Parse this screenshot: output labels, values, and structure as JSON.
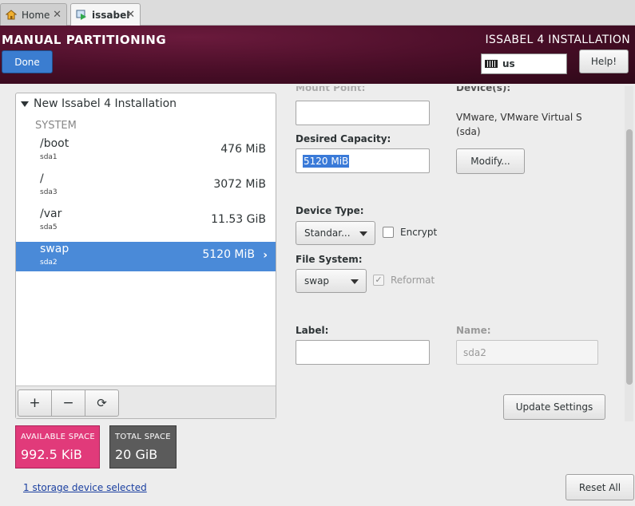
{
  "browser": {
    "tabs": [
      {
        "label": "Home",
        "icon": "home-icon"
      },
      {
        "label": "issabel",
        "icon": "vm-play-icon"
      }
    ],
    "close_glyph": "✕"
  },
  "header": {
    "title": "MANUAL PARTITIONING",
    "done_label": "Done",
    "install_title": "ISSABEL 4 INSTALLATION",
    "keyboard_layout": "us",
    "help_label": "Help!",
    "colors": {
      "banner": "#4a0e28",
      "done_button": "#3b7dd0"
    }
  },
  "partitions": {
    "install_heading": "New Issabel 4 Installation",
    "group_label": "SYSTEM",
    "rows": [
      {
        "mount": "/boot",
        "device": "sda1",
        "size": "476 MiB",
        "selected": false
      },
      {
        "mount": "/",
        "device": "sda3",
        "size": "3072 MiB",
        "selected": false
      },
      {
        "mount": "/var",
        "device": "sda5",
        "size": "11.53 GiB",
        "selected": false
      },
      {
        "mount": "swap",
        "device": "sda2",
        "size": "5120 MiB",
        "selected": true
      }
    ],
    "toolbar": {
      "add_glyph": "+",
      "remove_glyph": "−",
      "refresh_glyph": "⟳"
    },
    "selected_color": "#4a8ad8"
  },
  "space": {
    "available_label": "AVAILABLE SPACE",
    "available_value": "992.5 KiB",
    "total_label": "TOTAL SPACE",
    "total_value": "20 GiB",
    "available_color": "#e13a7a",
    "total_color": "#5b5b5b"
  },
  "storage_link": "1 storage device selected",
  "details": {
    "mount_point_label": "Mount Point:",
    "mount_point_value": "",
    "desired_capacity_label": "Desired Capacity:",
    "desired_capacity_value": "5120 MiB",
    "devices_label": "Device(s):",
    "devices_desc": "VMware, VMware Virtual S (sda)",
    "modify_label": "Modify...",
    "device_type_label": "Device Type:",
    "device_type_value": "Standar...",
    "encrypt_label": "Encrypt",
    "encrypt_checked": false,
    "file_system_label": "File System:",
    "file_system_value": "swap",
    "reformat_label": "Reformat",
    "reformat_checked": true,
    "label_label": "Label:",
    "label_value": "",
    "name_label": "Name:",
    "name_value": "sda2",
    "update_label": "Update Settings"
  },
  "reset_label": "Reset All"
}
